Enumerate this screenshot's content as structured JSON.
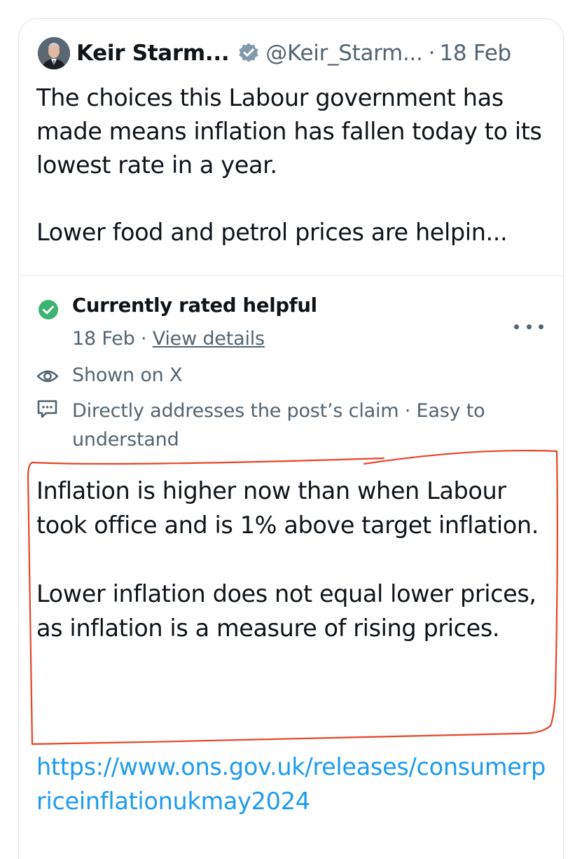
{
  "post": {
    "author_name": "Keir Starm...",
    "handle": "@Keir_Starm...",
    "separator": "·",
    "date": "18 Feb",
    "text_paragraphs": [
      "The choices this Labour government has made means inflation has fallen today to its lowest rate in a year.",
      "Lower food and petrol prices are helpin..."
    ]
  },
  "community_note": {
    "status": "Currently rated helpful",
    "date": "18 Feb",
    "meta_separator": " · ",
    "view_details_label": "View details",
    "shown_on": "Shown on X",
    "reasons": "Directly addresses the post’s claim · Easy to understand",
    "text_paragraphs": [
      "Inflation is higher now than when Labour took office and is 1% above target inflation.",
      "Lower inflation does not equal lower prices, as inflation is a measure of rising prices."
    ],
    "link": "https://www.ons.gov.uk/releases/consumerpriceinflationukmay2024"
  },
  "icons": {
    "verified": "verified-badge-icon",
    "rated": "check-circle-icon",
    "shown": "eye-icon",
    "reasons": "comment-icon",
    "more": "more-icon"
  },
  "colors": {
    "text": "#0f1419",
    "secondary": "#536471",
    "link": "#1d9bf0",
    "helpful_green": "#3cb371",
    "annotation_red": "#e8442a"
  }
}
